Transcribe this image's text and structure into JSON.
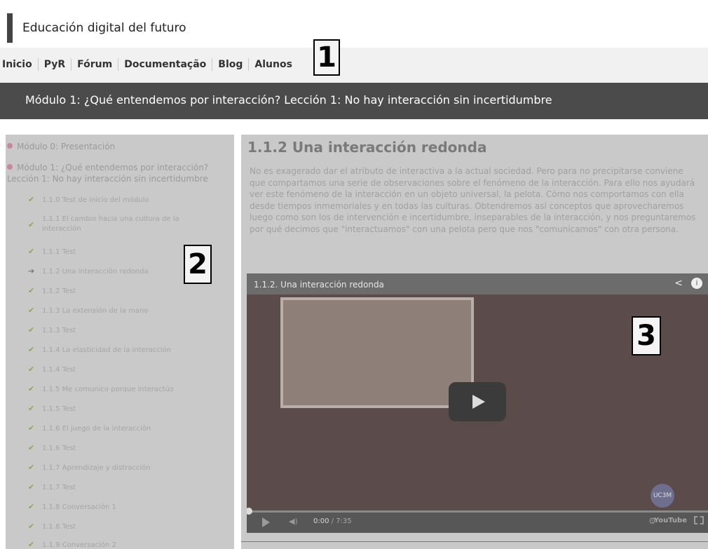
{
  "site": {
    "title": "Educación digital del futuro"
  },
  "nav": {
    "items": [
      "Inicio",
      "PyR",
      "Fórum",
      "Documentação",
      "Blog",
      "Alunos"
    ]
  },
  "callouts": [
    "1",
    "2",
    "3"
  ],
  "module_bar": {
    "title": "Módulo 1: ¿Qué entendemos por interacción? Lección 1: No hay interacción sin incertidumbre"
  },
  "sidebar": {
    "modules": [
      {
        "label": "Módulo 0: Presentación"
      },
      {
        "label": "Módulo 1: ¿Qué entendemos por interacción? Lección 1: No hay interacción sin incertidumbre"
      }
    ],
    "lessons": [
      {
        "label": "1.1.0 Test de inicio del módulo",
        "icon": "check-icon"
      },
      {
        "label": "1.1.1 El cambio hacia una cultura de la interacción",
        "icon": "check-icon"
      },
      {
        "label": "1.1.1 Test",
        "icon": "check-icon"
      },
      {
        "label": "1.1.2 Una interacción redonda",
        "icon": "arrow-circle-icon",
        "current": true
      },
      {
        "label": "1.1.2 Test",
        "icon": "check-icon"
      },
      {
        "label": "1.1.3 La extensión de la mano",
        "icon": "check-icon"
      },
      {
        "label": "1.1.3 Test",
        "icon": "check-icon"
      },
      {
        "label": "1.1.4 La elasticidad de la interacción",
        "icon": "check-icon"
      },
      {
        "label": "1.1.4 Test",
        "icon": "check-icon"
      },
      {
        "label": "1.1.5 Me comunico porque interactúo",
        "icon": "check-icon"
      },
      {
        "label": "1.1.5 Test",
        "icon": "check-icon"
      },
      {
        "label": "1.1.6 El juego de la interacción",
        "icon": "check-icon"
      },
      {
        "label": "1.1.6 Test",
        "icon": "check-icon"
      },
      {
        "label": "1.1.7 Aprendizaje y distracción",
        "icon": "check-icon"
      },
      {
        "label": "1.1.7 Test",
        "icon": "check-icon"
      },
      {
        "label": "1.1.8 Conversación 1",
        "icon": "check-icon"
      },
      {
        "label": "1.1.8 Test",
        "icon": "check-icon"
      },
      {
        "label": "1.1.9 Conversación 2",
        "icon": "check-icon"
      }
    ]
  },
  "content": {
    "heading": "1.1.2 Una interacción redonda",
    "paragraph": "No es exagerado dar el atributo de interactiva a la actual sociedad. Pero para no precipitarse conviene que compartamos una serie de observaciones sobre el fenómeno de la interacción. Para ello nos ayudará ver este fenómeno de la interacción en un objeto universal, la pelota. Cómo nos comportamos con ella desde tiempos inmemoriales y en todas las culturas. Obtendremos así conceptos que aprovecharemos luego como son los de intervención e incertidumbre, inseparables de la interacción, y nos preguntaremos por qué decimos que \"interactuamos\" con una pelota pero que nos \"comunicamos\" con otra persona."
  },
  "video": {
    "title": "1.1.2. Una interacción redonda",
    "current_time": "0:00",
    "duration": "/ 7:35",
    "logo": "UC3M",
    "brand": "YouTube",
    "progress": 0
  }
}
